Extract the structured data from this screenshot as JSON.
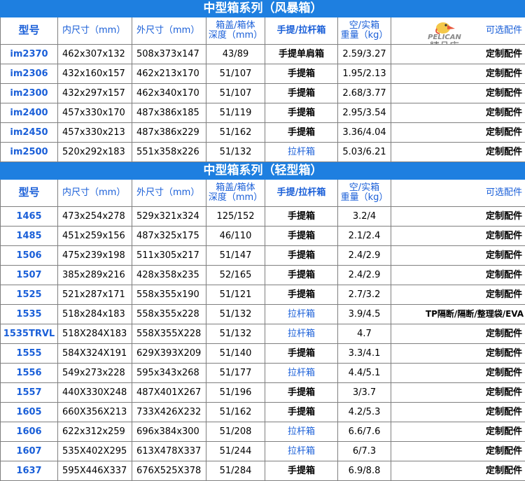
{
  "sections": [
    {
      "title": "中型箱系列（风暴箱）",
      "headers": [
        "型号",
        "内尺寸（mm）",
        "外尺寸（mm）",
        "箱盖/箱体\n深度（mm）",
        "手提/拉杆箱",
        "空/实箱\n重量（kg）",
        "可选配件"
      ],
      "rows": [
        [
          "im2370",
          "462x307x132",
          "508x373x147",
          "43/89",
          "手提单肩箱",
          "2.59/3.27",
          "定制配件"
        ],
        [
          "im2306",
          "432x160x157",
          "462x213x170",
          "51/107",
          "手提箱",
          "1.95/2.13",
          "定制配件"
        ],
        [
          "im2300",
          "432x297x157",
          "462x340x170",
          "51/107",
          "手提箱",
          "2.68/3.77",
          "定制配件"
        ],
        [
          "im2400",
          "457x330x170",
          "487x386x185",
          "51/119",
          "手提箱",
          "2.95/3.54",
          "定制配件"
        ],
        [
          "im2450",
          "457x330x213",
          "487x386x229",
          "51/162",
          "手提箱",
          "3.36/4.04",
          "定制配件"
        ],
        [
          "im2500",
          "520x292x183",
          "551x358x226",
          "51/132",
          "拉杆箱",
          "5.03/6.21",
          "定制配件"
        ]
      ]
    },
    {
      "title": "中型箱系列（轻型箱）",
      "headers": [
        "型号",
        "内尺寸（mm）",
        "外尺寸（mm）",
        "箱盖/箱体\n深度（mm）",
        "手提/拉杆箱",
        "空/实箱\n重量（kg）",
        "可选配件"
      ],
      "rows": [
        [
          "1465",
          "473x254x278",
          "529x321x324",
          "125/152",
          "手提箱",
          "3.2/4",
          "定制配件"
        ],
        [
          "1485",
          "451x259x156",
          "487x325x175",
          "46/110",
          "手提箱",
          "2.1/2.4",
          "定制配件"
        ],
        [
          "1506",
          "475x239x198",
          "511x305x217",
          "51/147",
          "手提箱",
          "2.4/2.9",
          "定制配件"
        ],
        [
          "1507",
          "385x289x216",
          "428x358x235",
          "52/165",
          "手提箱",
          "2.4/2.9",
          "定制配件"
        ],
        [
          "1525",
          "521x287x171",
          "558x355x190",
          "51/121",
          "手提箱",
          "2.7/3.2",
          "定制配件"
        ],
        [
          "1535",
          "518x284x183",
          "558x355x228",
          "51/132",
          "拉杆箱",
          "3.9/4.5",
          "TP隔断/隔断/整理袋/EVA"
        ],
        [
          "1535TRVL",
          "518X284X183",
          "558X355X228",
          "51/132",
          "拉杆箱",
          "4.7",
          "定制配件"
        ],
        [
          "1555",
          "584X324X191",
          "629X393X209",
          "51/140",
          "手提箱",
          "3.3/4.1",
          "定制配件"
        ],
        [
          "1556",
          "549x273x228",
          "595x343x268",
          "51/177",
          "拉杆箱",
          "4.4/5.1",
          "定制配件"
        ],
        [
          "1557",
          "440X330X248",
          "487X401X267",
          "51/196",
          "手提箱",
          "3/3.7",
          "定制配件"
        ],
        [
          "1605",
          "660X356X213",
          "733X426X232",
          "51/162",
          "手提箱",
          "4.2/5.3",
          "定制配件"
        ],
        [
          "1606",
          "622x312x259",
          "696x384x300",
          "51/208",
          "拉杆箱",
          "6.6/7.6",
          "定制配件"
        ],
        [
          "1607",
          "535X402X295",
          "613X478X337",
          "51/244",
          "拉杆箱",
          "6/7.3",
          "定制配件"
        ],
        [
          "1637",
          "595X446X337",
          "676X525X378",
          "51/284",
          "手提箱",
          "6.9/8.8",
          "定制配件"
        ]
      ]
    }
  ],
  "watermark": {
    "brand": "PELICAN",
    "store": "精品店"
  },
  "colors": {
    "title_bg": "#1e7fe0",
    "accent_blue": "#1a5fd8"
  },
  "icons": {
    "logo": "pelican-bird-icon"
  }
}
